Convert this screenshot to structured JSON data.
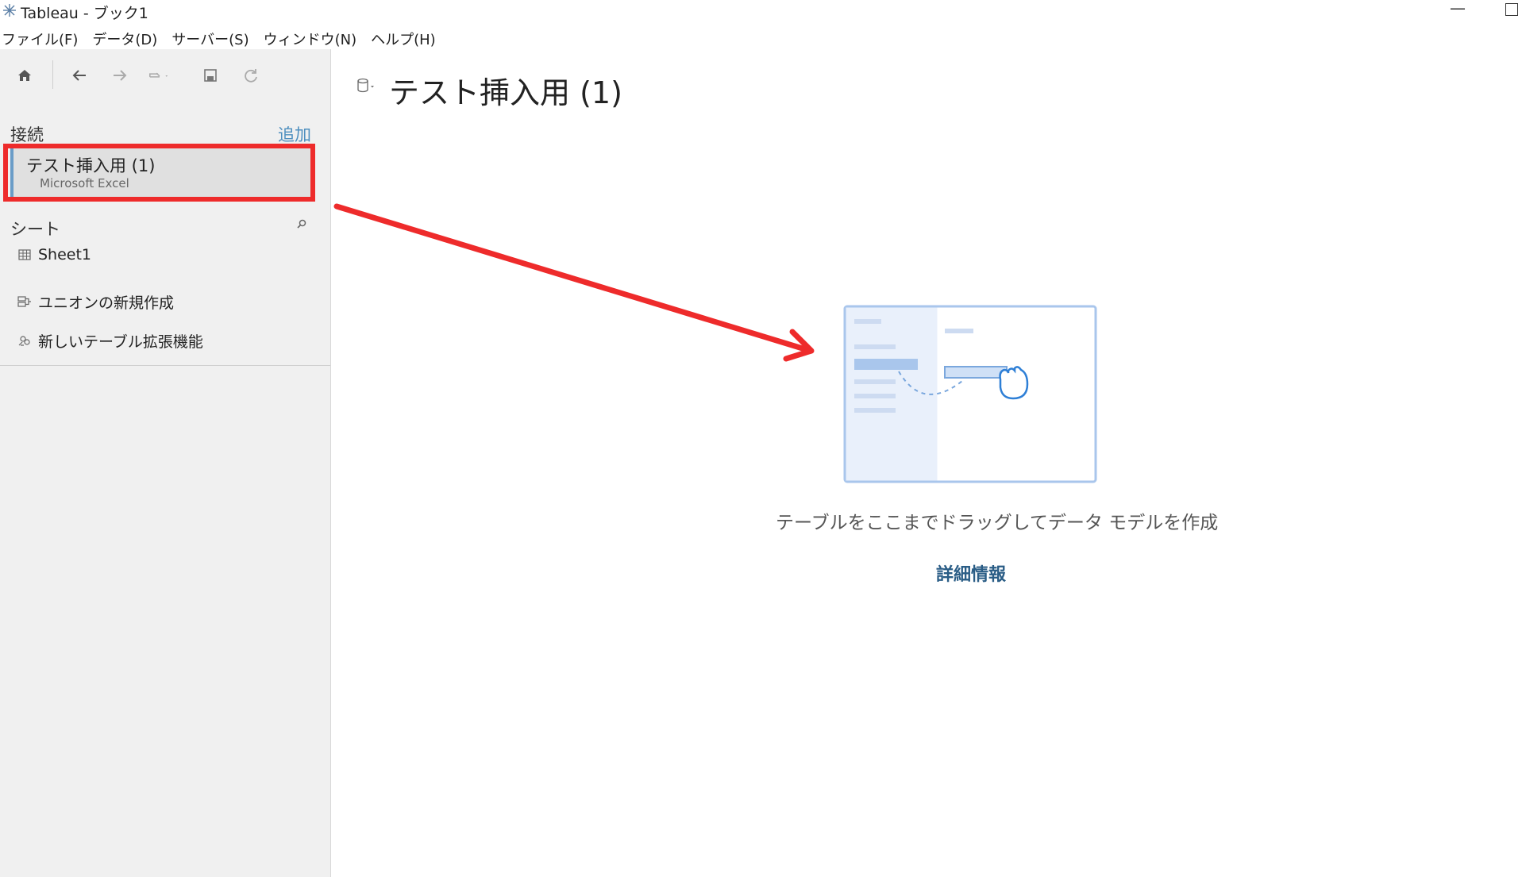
{
  "window": {
    "title": "Tableau - ブック1",
    "minimize_glyph": "—"
  },
  "menu": [
    {
      "label": "ファイル(F)"
    },
    {
      "label": "データ(D)"
    },
    {
      "label": "サーバー(S)"
    },
    {
      "label": "ウィンドウ(N)"
    },
    {
      "label": "ヘルプ(H)"
    }
  ],
  "toolbar": {
    "icons": [
      "home-icon",
      "back-arrow-icon",
      "forward-arrow-icon",
      "redo-icon",
      "save-icon",
      "refresh-icon"
    ]
  },
  "sidebar": {
    "connections_label": "接続",
    "add_label": "追加",
    "connection": {
      "name": "テスト挿入用 (1)",
      "type": "Microsoft Excel"
    },
    "sheets_label": "シート",
    "sheets": [
      {
        "label": "Sheet1",
        "icon": "table-grid-icon"
      }
    ],
    "actions": [
      {
        "label": "ユニオンの新規作成",
        "icon": "union-icon"
      },
      {
        "label": "新しいテーブル拡張機能",
        "icon": "table-extension-icon"
      }
    ]
  },
  "main": {
    "datasource_title": "テスト挿入用 (1)",
    "drop_hint": "テーブルをここまでドラッグしてデータ モデルを作成",
    "learn_more": "詳細情報"
  },
  "annotation": {
    "highlight_color": "#ee2b2b"
  },
  "colors": {
    "accent_link": "#4e8fbf",
    "connection_bar": "#6a9cc7",
    "learn_more": "#2a5d86"
  }
}
